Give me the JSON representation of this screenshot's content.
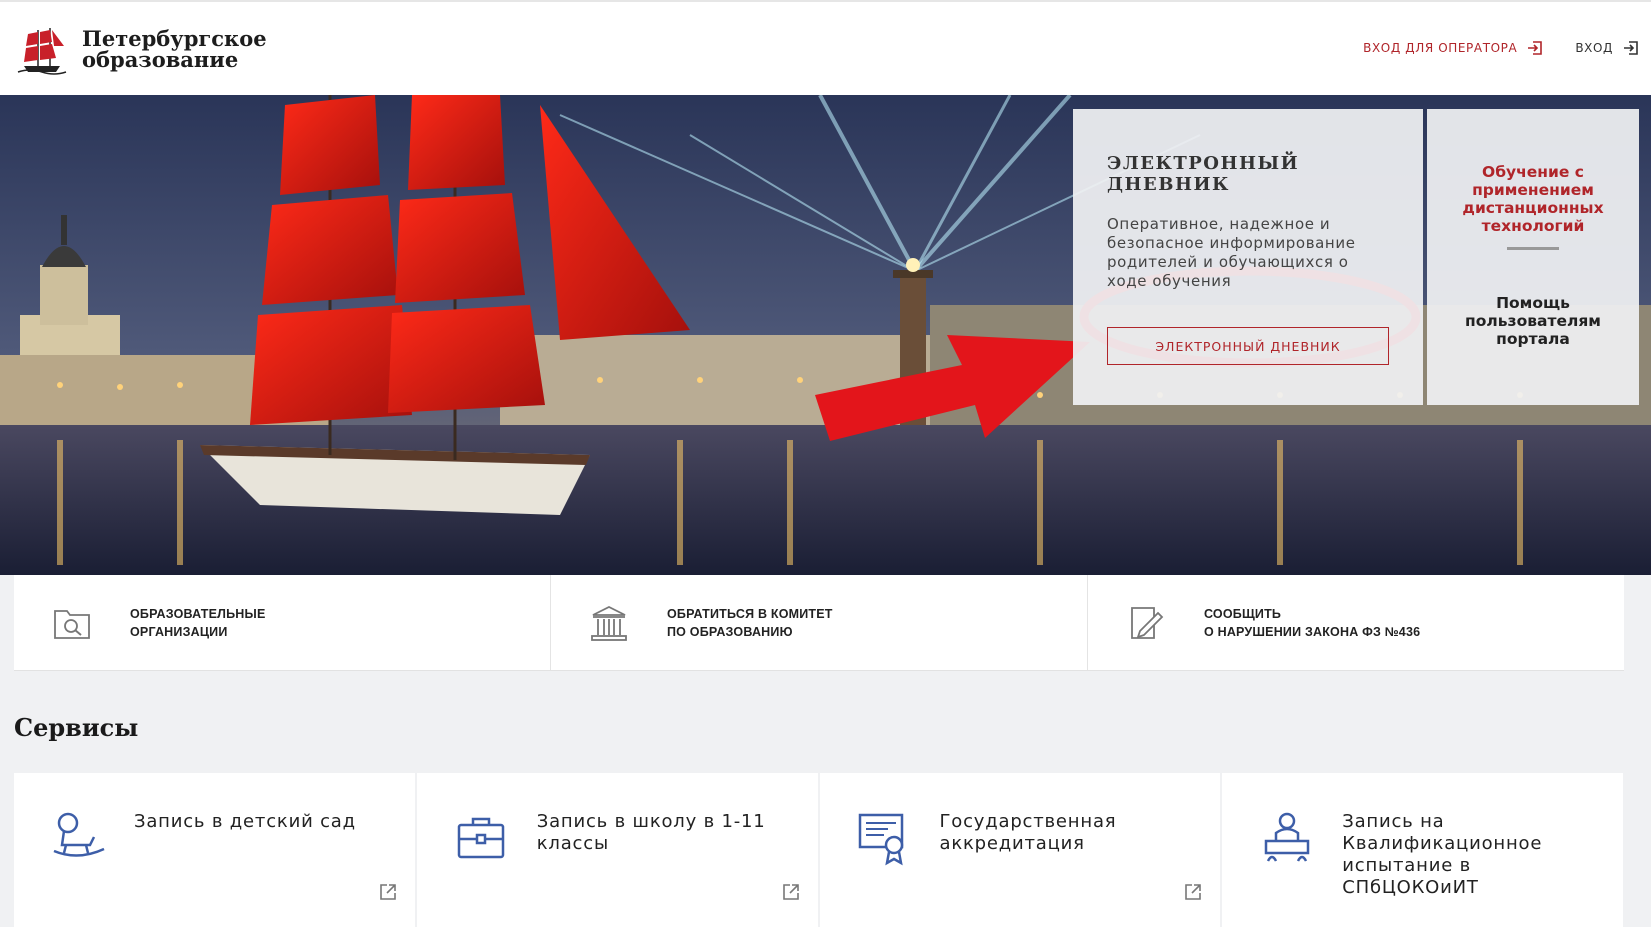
{
  "header": {
    "logo_line1": "Петербургское",
    "logo_line2": "образование",
    "operator_login": "ВХОД ДЛЯ ОПЕРАТОРА",
    "login": "ВХОД"
  },
  "hero": {
    "diary_card": {
      "title": "ЭЛЕКТРОННЫЙ ДНЕВНИК",
      "description": "Оперативное, надежное и безопасное информирование родителей и обучающихся о ходе обучения",
      "button_label": "ЭЛЕКТРОННЫЙ ДНЕВНИК"
    },
    "side_card": {
      "remote_learning": "Обучение с применением дистанционных технологий",
      "help": "Помощь пользователям портала"
    },
    "colors": {
      "accent": "#b0252a",
      "annotation": "#e3151b"
    }
  },
  "quick_links": [
    {
      "line1": "ОБРАЗОВАТЕЛЬНЫЕ",
      "line2": "ОРГАНИЗАЦИИ",
      "icon": "folder-search-icon"
    },
    {
      "line1": "ОБРАТИТЬСЯ В КОМИТЕТ",
      "line2": "ПО ОБРАЗОВАНИЮ",
      "icon": "building-icon"
    },
    {
      "line1": "СООБЩИТЬ",
      "line2": "О НАРУШЕНИИ ЗАКОНА ФЗ №436",
      "icon": "edit-document-icon"
    }
  ],
  "services": {
    "title": "Сервисы",
    "items": [
      {
        "label": "Запись в детский сад",
        "icon": "rocking-horse-icon",
        "external": true
      },
      {
        "label": "Запись в школу в 1-11 классы",
        "icon": "briefcase-icon",
        "external": true
      },
      {
        "label": "Государственная аккредитация",
        "icon": "certificate-icon",
        "external": true
      },
      {
        "label": "Запись на Квалификационное испытание в СПбЦОКОиИТ",
        "icon": "teacher-icon",
        "external": false
      }
    ]
  }
}
